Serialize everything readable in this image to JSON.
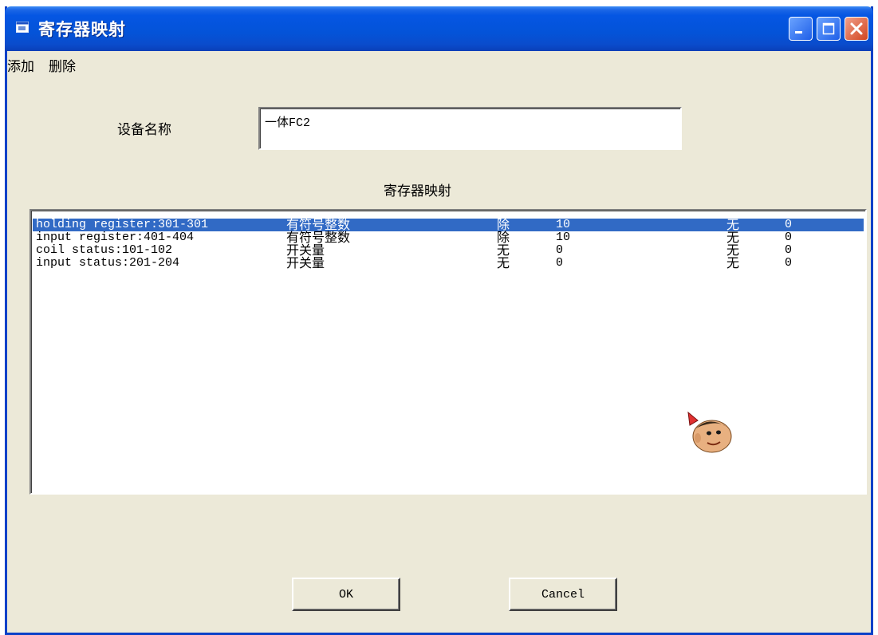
{
  "window": {
    "title": "寄存器映射"
  },
  "menu": {
    "add_label": "添加",
    "delete_label": "删除"
  },
  "device": {
    "label": "设备名称",
    "value": "一体FC2"
  },
  "mapping": {
    "section_title": "寄存器映射",
    "rows": [
      {
        "register": "holding register:301-301",
        "type": "有符号整数",
        "op": "除",
        "factor": "10",
        "op2": "无",
        "value2": "0",
        "selected": true
      },
      {
        "register": "input register:401-404",
        "type": "有符号整数",
        "op": "除",
        "factor": "10",
        "op2": "无",
        "value2": "0",
        "selected": false
      },
      {
        "register": "coil status:101-102",
        "type": "开关量",
        "op": "无",
        "factor": "0",
        "op2": "无",
        "value2": "0",
        "selected": false
      },
      {
        "register": "input status:201-204",
        "type": "开关量",
        "op": "无",
        "factor": "0",
        "op2": "无",
        "value2": "0",
        "selected": false
      }
    ]
  },
  "buttons": {
    "ok_label": "OK",
    "cancel_label": "Cancel"
  },
  "colors": {
    "titlebar": "#0453d8",
    "selection": "#316ac5",
    "face": "#ece9d8"
  },
  "icons": {
    "app": "window-icon",
    "assistant": "office-assistant-icon"
  }
}
